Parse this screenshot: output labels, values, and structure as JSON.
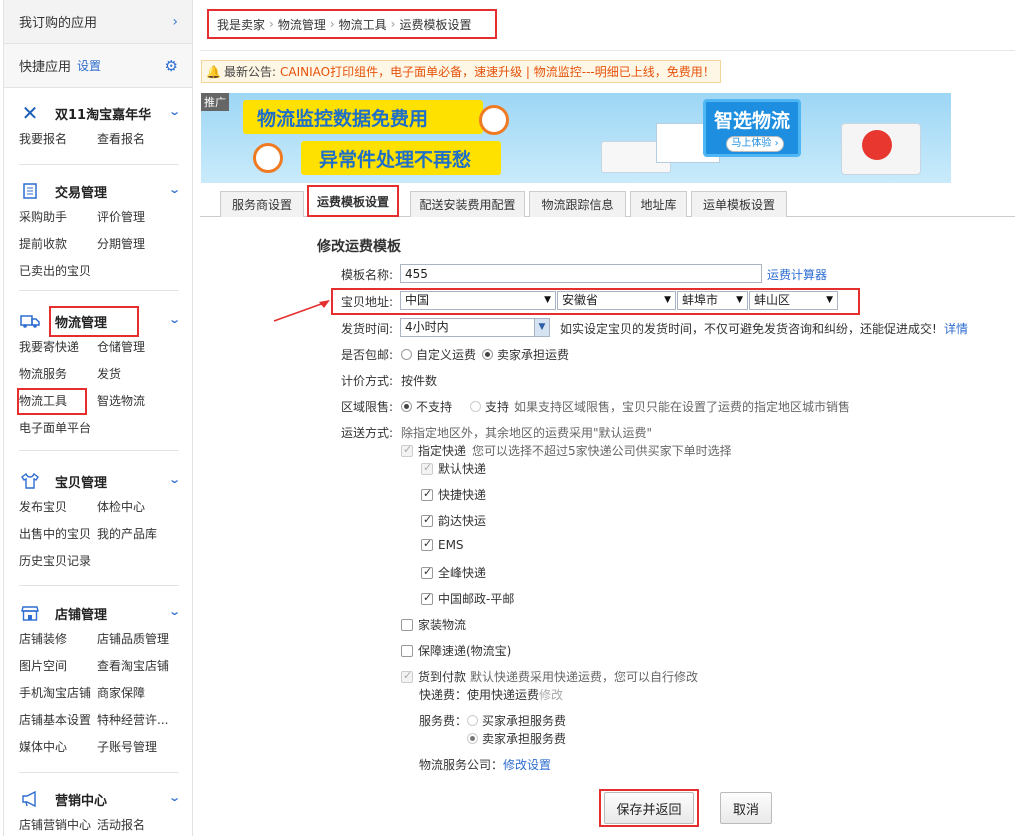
{
  "sidebar": {
    "top": {
      "label": "我订购的应用",
      "chevron": "›"
    },
    "quick": {
      "label": "快捷应用",
      "settings_link": "设置",
      "gear_icon": "gear-icon"
    },
    "groups": [
      {
        "icon": "close-x-icon",
        "title": "双11淘宝嘉年华",
        "items": [
          "我要报名",
          "查看报名"
        ]
      },
      {
        "icon": "ledger-icon",
        "title": "交易管理",
        "items": [
          "采购助手",
          "评价管理",
          "提前收款",
          "分期管理",
          "已卖出的宝贝"
        ]
      },
      {
        "icon": "truck-icon",
        "title": "物流管理",
        "items": [
          "我要寄快递",
          "仓储管理",
          "物流服务",
          "发货",
          "物流工具",
          "智选物流",
          "电子面单平台"
        ]
      },
      {
        "icon": "shirt-icon",
        "title": "宝贝管理",
        "items": [
          "发布宝贝",
          "体检中心",
          "出售中的宝贝",
          "我的产品库",
          "历史宝贝记录"
        ]
      },
      {
        "icon": "shop-icon",
        "title": "店铺管理",
        "items": [
          "店铺装修",
          "店铺品质管理",
          "图片空间",
          "查看淘宝店铺",
          "手机淘宝店铺",
          "商家保障",
          "店铺基本设置",
          "特种经营许...",
          "媒体中心",
          "子账号管理"
        ]
      },
      {
        "icon": "megaphone-icon",
        "title": "营销中心",
        "items": [
          "店铺营销中心",
          "活动报名"
        ]
      }
    ]
  },
  "breadcrumb": [
    "我是卖家",
    "物流管理",
    "物流工具",
    "运费模板设置"
  ],
  "breadcrumb_sep": "›",
  "notice": {
    "prefix": "最新公告:",
    "text": "CAINIAO打印组件，电子面单必备，速速升级 | 物流监控---明细已上线，免费用！"
  },
  "banner": {
    "tag": "推广",
    "line1": "物流监控数据免费用",
    "line2": "异常件处理不再愁",
    "brand": "智选物流",
    "brand_button": "马上体验 ›"
  },
  "tabs": [
    "服务商设置",
    "运费模板设置",
    "配送安装费用配置",
    "物流跟踪信息",
    "地址库",
    "运单模板设置"
  ],
  "active_tab": 1,
  "form": {
    "title": "修改运费模板",
    "name_label": "模板名称:",
    "name_value": "455",
    "calc_link": "运费计算器",
    "address_label": "宝贝地址:",
    "address": {
      "country": "中国",
      "province": "安徽省",
      "city": "蚌埠市",
      "district": "蚌山区"
    },
    "ship_time_label": "发货时间:",
    "ship_time_value": "4小时内",
    "ship_time_hint": "如实设定宝贝的发货时间，不仅可避免发货咨询和纠纷，还能促进成交!",
    "ship_time_link": "详情",
    "free_ship_label": "是否包邮:",
    "free_ship_options": [
      "自定义运费",
      "卖家承担运费"
    ],
    "free_ship_selected": 1,
    "pricing_label": "计价方式:",
    "pricing_value": "按件数",
    "region_label": "区域限售:",
    "region_options": [
      "不支持",
      "支持"
    ],
    "region_selected": 0,
    "region_hint": "如果支持区域限售，宝贝只能在设置了运费的指定地区城市销售",
    "delivery_label": "运送方式:",
    "delivery_hint": "除指定地区外，其余地区的运费采用\"默认运费\"",
    "express": {
      "label": "指定快递",
      "hint": "您可以选择不超过5家快递公司供买家下单时选择"
    },
    "express_companies": [
      "默认快递",
      "快捷快递",
      "韵达快运",
      "EMS",
      "全峰快递",
      "中国邮政-平邮"
    ],
    "home_install": "家装物流",
    "guaranteed": "保障速递(物流宝)",
    "cod": {
      "label": "货到付款",
      "hint": "默认快递费采用快递运费，您可以自行修改"
    },
    "cod_fee": {
      "label": "快递费：",
      "value": "使用快递运费",
      "modify": "修改"
    },
    "service_fee": {
      "label": "服务费：",
      "options": [
        "买家承担服务费",
        "卖家承担服务费"
      ],
      "selected": 1
    },
    "logistics_company": {
      "label": "物流服务公司：",
      "link": "修改设置"
    },
    "save_button": "保存并返回",
    "cancel_button": "取消"
  },
  "colors": {
    "highlight": "#e52e2e",
    "link": "#2e6dd1",
    "notice": "#e4520c"
  }
}
